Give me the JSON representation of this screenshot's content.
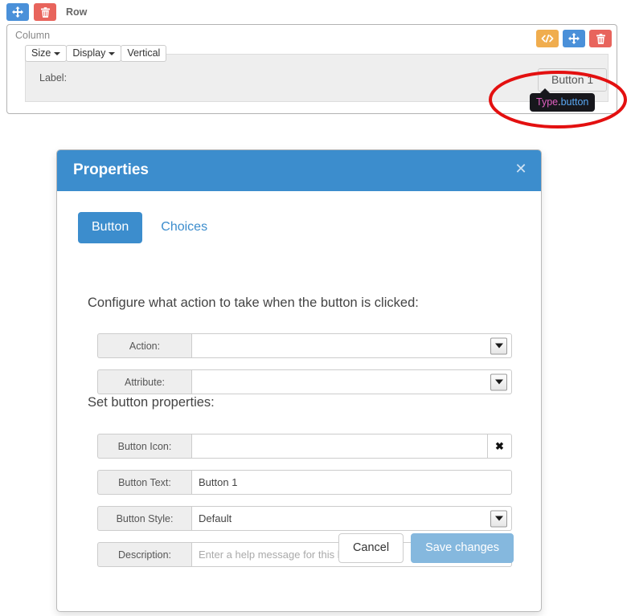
{
  "builder": {
    "row": {
      "label": "Row",
      "move_icon": "move-arrows-icon",
      "delete_icon": "trash-icon"
    },
    "column": {
      "label": "Column",
      "code_icon": "code-brackets-icon",
      "move_icon": "move-arrows-icon",
      "delete_icon": "trash-icon"
    },
    "field_toolbar": {
      "size_label": "Size",
      "display_label": "Display",
      "vertical_label": "Vertical"
    },
    "field": {
      "label": "Label:",
      "button_text": "Button 1"
    },
    "tooltip": {
      "type": "Type",
      "separator": ".",
      "property": "button"
    },
    "annotation": {
      "shape": "ellipse",
      "color": "#e31010"
    }
  },
  "modal": {
    "title": "Properties",
    "close_icon": "close-icon",
    "header_color": "#3c8dcd",
    "tabs": [
      {
        "label": "Button",
        "active": true
      },
      {
        "label": "Choices",
        "active": false
      }
    ],
    "sections": [
      {
        "heading": "Configure what action to take when the button is clicked:"
      },
      {
        "heading": "Set button properties:"
      }
    ],
    "fields": {
      "action": {
        "label": "Action:",
        "value": "",
        "control": "select"
      },
      "attribute": {
        "label": "Attribute:",
        "value": "",
        "control": "select"
      },
      "button_icon": {
        "label": "Button Icon:",
        "value": "",
        "control": "text-with-clear",
        "clear_icon": "clear-x-icon"
      },
      "button_text": {
        "label": "Button Text:",
        "value": "Button 1",
        "control": "text"
      },
      "button_style": {
        "label": "Button Style:",
        "value": "Default",
        "control": "select"
      },
      "description": {
        "label": "Description:",
        "value": "",
        "placeholder": "Enter a help message for this button",
        "control": "text"
      }
    },
    "footer": {
      "cancel_label": "Cancel",
      "save_label": "Save changes",
      "save_color": "#85b8de"
    }
  }
}
